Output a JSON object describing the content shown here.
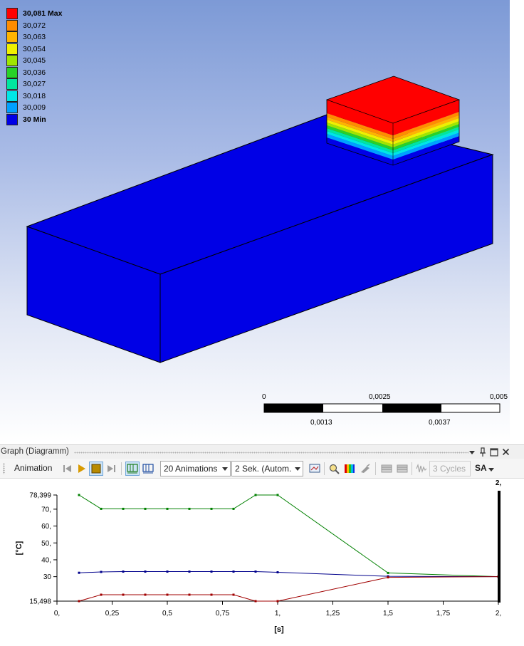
{
  "legend": {
    "items": [
      {
        "label": "30,081 Max",
        "color": "#ff0000",
        "bold": true
      },
      {
        "label": "30,072",
        "color": "#ff8c00",
        "bold": false
      },
      {
        "label": "30,063",
        "color": "#ffb400",
        "bold": false
      },
      {
        "label": "30,054",
        "color": "#f0f000",
        "bold": false
      },
      {
        "label": "30,045",
        "color": "#a0e600",
        "bold": false
      },
      {
        "label": "30,036",
        "color": "#28d228",
        "bold": false
      },
      {
        "label": "30,027",
        "color": "#00e6a0",
        "bold": false
      },
      {
        "label": "30,018",
        "color": "#00e6e6",
        "bold": false
      },
      {
        "label": "30,009",
        "color": "#00a0ff",
        "bold": false
      },
      {
        "label": "30 Min",
        "color": "#0000e6",
        "bold": true
      }
    ]
  },
  "scale_bar": {
    "top_labels": [
      "0",
      "0,0025",
      "0,005"
    ],
    "bottom_labels": [
      "0,0013",
      "0,0037"
    ]
  },
  "graph_panel": {
    "title": "Graph (Diagramm)",
    "toolbar": {
      "animation_label": "Animation",
      "frames_dropdown": "20 Animations",
      "duration_dropdown": "2 Sek. (Autom.",
      "cycles_label": "3 Cycles",
      "sa_label": "SA"
    }
  },
  "chart_data": {
    "type": "line",
    "xlabel": "[s]",
    "ylabel": "[°C]",
    "xlim": [
      0,
      2
    ],
    "ylim": [
      15.498,
      78.399
    ],
    "x_ticks": [
      {
        "v": 0,
        "label": "0,"
      },
      {
        "v": 0.25,
        "label": "0,25"
      },
      {
        "v": 0.5,
        "label": "0,5"
      },
      {
        "v": 0.75,
        "label": "0,75"
      },
      {
        "v": 1,
        "label": "1,"
      },
      {
        "v": 1.25,
        "label": "1,25"
      },
      {
        "v": 1.5,
        "label": "1,5"
      },
      {
        "v": 1.75,
        "label": "1,75"
      },
      {
        "v": 2,
        "label": "2,"
      }
    ],
    "y_ticks": [
      {
        "v": 15.498,
        "label": "15,498"
      },
      {
        "v": 30,
        "label": "30"
      },
      {
        "v": 40,
        "label": "40,"
      },
      {
        "v": 50,
        "label": "50,"
      },
      {
        "v": 60,
        "label": "60,"
      },
      {
        "v": 70,
        "label": "70,"
      },
      {
        "v": 78.399,
        "label": "78,399"
      }
    ],
    "current_time_label": "2,",
    "current_time": 2,
    "series": [
      {
        "color": "#008000",
        "x": [
          0.1,
          0.2,
          0.3,
          0.4,
          0.5,
          0.6,
          0.7,
          0.8,
          0.9,
          1.0,
          1.5,
          2.0
        ],
        "y": [
          78.399,
          70.2,
          70.2,
          70.2,
          70.2,
          70.2,
          70.2,
          70.2,
          78.399,
          78.399,
          32.2,
          30.0
        ]
      },
      {
        "color": "#00008b",
        "x": [
          0.1,
          0.2,
          0.3,
          0.4,
          0.5,
          0.6,
          0.7,
          0.8,
          0.9,
          1.0,
          1.5,
          2.0
        ],
        "y": [
          32.3,
          32.8,
          33.0,
          33.0,
          33.0,
          33.0,
          33.0,
          33.0,
          33.0,
          32.6,
          30.2,
          30.0
        ]
      },
      {
        "color": "#a00000",
        "x": [
          0.1,
          0.2,
          0.3,
          0.4,
          0.5,
          0.6,
          0.7,
          0.8,
          0.9,
          1.0,
          1.5,
          2.0
        ],
        "y": [
          15.498,
          19.3,
          19.3,
          19.3,
          19.3,
          19.3,
          19.3,
          19.3,
          15.498,
          15.498,
          29.6,
          30.0
        ]
      }
    ]
  }
}
